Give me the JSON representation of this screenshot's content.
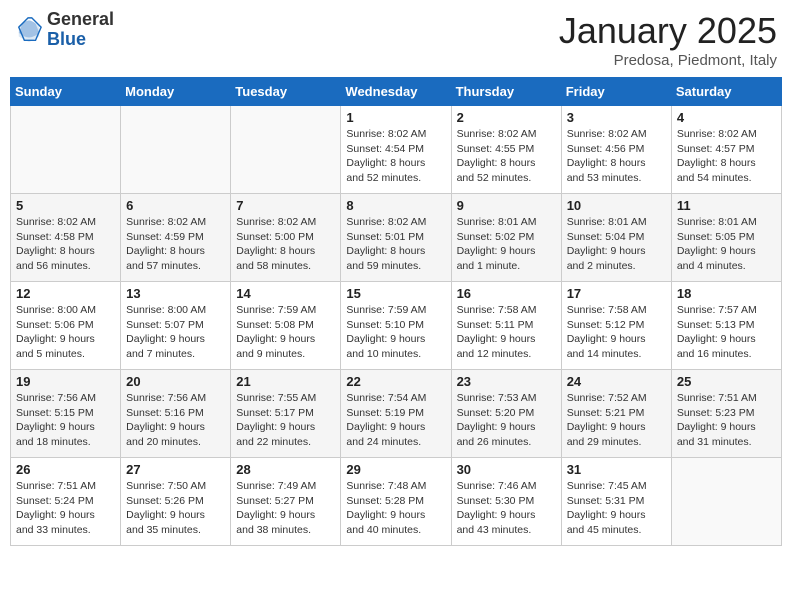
{
  "header": {
    "logo_general": "General",
    "logo_blue": "Blue",
    "title": "January 2025",
    "subtitle": "Predosa, Piedmont, Italy"
  },
  "weekdays": [
    "Sunday",
    "Monday",
    "Tuesday",
    "Wednesday",
    "Thursday",
    "Friday",
    "Saturday"
  ],
  "weeks": [
    [
      {
        "day": "",
        "info": ""
      },
      {
        "day": "",
        "info": ""
      },
      {
        "day": "",
        "info": ""
      },
      {
        "day": "1",
        "info": "Sunrise: 8:02 AM\nSunset: 4:54 PM\nDaylight: 8 hours and 52 minutes."
      },
      {
        "day": "2",
        "info": "Sunrise: 8:02 AM\nSunset: 4:55 PM\nDaylight: 8 hours and 52 minutes."
      },
      {
        "day": "3",
        "info": "Sunrise: 8:02 AM\nSunset: 4:56 PM\nDaylight: 8 hours and 53 minutes."
      },
      {
        "day": "4",
        "info": "Sunrise: 8:02 AM\nSunset: 4:57 PM\nDaylight: 8 hours and 54 minutes."
      }
    ],
    [
      {
        "day": "5",
        "info": "Sunrise: 8:02 AM\nSunset: 4:58 PM\nDaylight: 8 hours and 56 minutes."
      },
      {
        "day": "6",
        "info": "Sunrise: 8:02 AM\nSunset: 4:59 PM\nDaylight: 8 hours and 57 minutes."
      },
      {
        "day": "7",
        "info": "Sunrise: 8:02 AM\nSunset: 5:00 PM\nDaylight: 8 hours and 58 minutes."
      },
      {
        "day": "8",
        "info": "Sunrise: 8:02 AM\nSunset: 5:01 PM\nDaylight: 8 hours and 59 minutes."
      },
      {
        "day": "9",
        "info": "Sunrise: 8:01 AM\nSunset: 5:02 PM\nDaylight: 9 hours and 1 minute."
      },
      {
        "day": "10",
        "info": "Sunrise: 8:01 AM\nSunset: 5:04 PM\nDaylight: 9 hours and 2 minutes."
      },
      {
        "day": "11",
        "info": "Sunrise: 8:01 AM\nSunset: 5:05 PM\nDaylight: 9 hours and 4 minutes."
      }
    ],
    [
      {
        "day": "12",
        "info": "Sunrise: 8:00 AM\nSunset: 5:06 PM\nDaylight: 9 hours and 5 minutes."
      },
      {
        "day": "13",
        "info": "Sunrise: 8:00 AM\nSunset: 5:07 PM\nDaylight: 9 hours and 7 minutes."
      },
      {
        "day": "14",
        "info": "Sunrise: 7:59 AM\nSunset: 5:08 PM\nDaylight: 9 hours and 9 minutes."
      },
      {
        "day": "15",
        "info": "Sunrise: 7:59 AM\nSunset: 5:10 PM\nDaylight: 9 hours and 10 minutes."
      },
      {
        "day": "16",
        "info": "Sunrise: 7:58 AM\nSunset: 5:11 PM\nDaylight: 9 hours and 12 minutes."
      },
      {
        "day": "17",
        "info": "Sunrise: 7:58 AM\nSunset: 5:12 PM\nDaylight: 9 hours and 14 minutes."
      },
      {
        "day": "18",
        "info": "Sunrise: 7:57 AM\nSunset: 5:13 PM\nDaylight: 9 hours and 16 minutes."
      }
    ],
    [
      {
        "day": "19",
        "info": "Sunrise: 7:56 AM\nSunset: 5:15 PM\nDaylight: 9 hours and 18 minutes."
      },
      {
        "day": "20",
        "info": "Sunrise: 7:56 AM\nSunset: 5:16 PM\nDaylight: 9 hours and 20 minutes."
      },
      {
        "day": "21",
        "info": "Sunrise: 7:55 AM\nSunset: 5:17 PM\nDaylight: 9 hours and 22 minutes."
      },
      {
        "day": "22",
        "info": "Sunrise: 7:54 AM\nSunset: 5:19 PM\nDaylight: 9 hours and 24 minutes."
      },
      {
        "day": "23",
        "info": "Sunrise: 7:53 AM\nSunset: 5:20 PM\nDaylight: 9 hours and 26 minutes."
      },
      {
        "day": "24",
        "info": "Sunrise: 7:52 AM\nSunset: 5:21 PM\nDaylight: 9 hours and 29 minutes."
      },
      {
        "day": "25",
        "info": "Sunrise: 7:51 AM\nSunset: 5:23 PM\nDaylight: 9 hours and 31 minutes."
      }
    ],
    [
      {
        "day": "26",
        "info": "Sunrise: 7:51 AM\nSunset: 5:24 PM\nDaylight: 9 hours and 33 minutes."
      },
      {
        "day": "27",
        "info": "Sunrise: 7:50 AM\nSunset: 5:26 PM\nDaylight: 9 hours and 35 minutes."
      },
      {
        "day": "28",
        "info": "Sunrise: 7:49 AM\nSunset: 5:27 PM\nDaylight: 9 hours and 38 minutes."
      },
      {
        "day": "29",
        "info": "Sunrise: 7:48 AM\nSunset: 5:28 PM\nDaylight: 9 hours and 40 minutes."
      },
      {
        "day": "30",
        "info": "Sunrise: 7:46 AM\nSunset: 5:30 PM\nDaylight: 9 hours and 43 minutes."
      },
      {
        "day": "31",
        "info": "Sunrise: 7:45 AM\nSunset: 5:31 PM\nDaylight: 9 hours and 45 minutes."
      },
      {
        "day": "",
        "info": ""
      }
    ]
  ]
}
